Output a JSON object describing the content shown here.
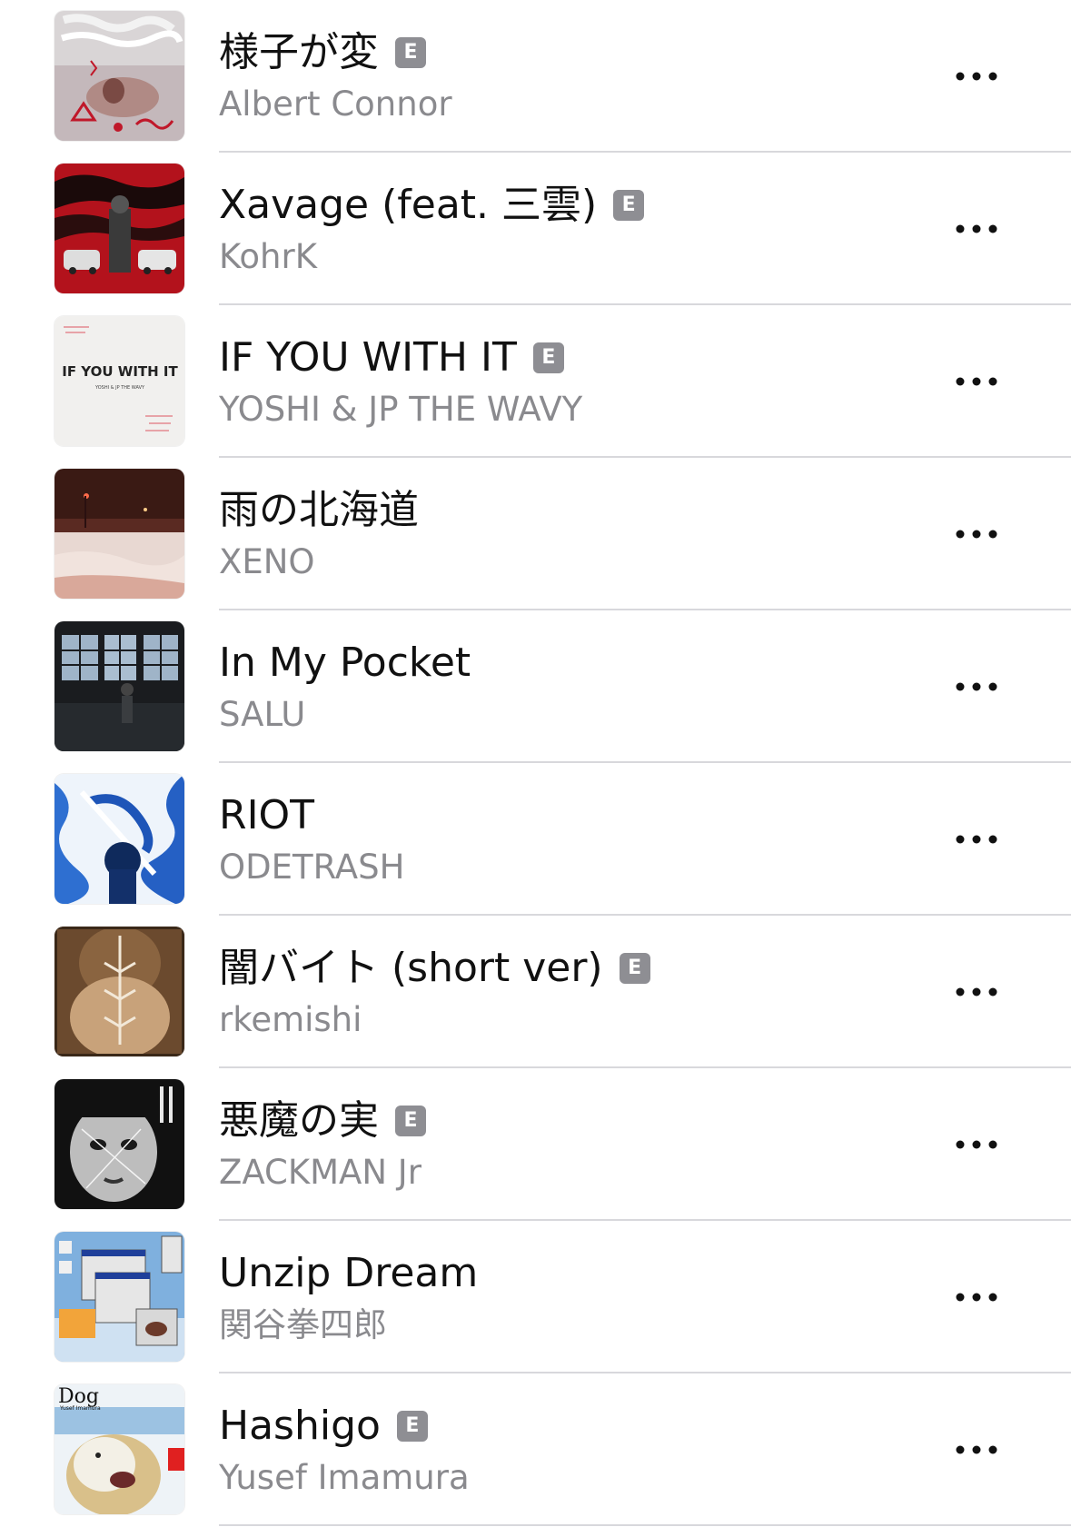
{
  "songs": [
    {
      "title": "様子が変",
      "artist": "Albert Connor",
      "explicit": true,
      "explicit_label": "E",
      "artwork": "album-artwork-25-joyboi"
    },
    {
      "title": "Xavage (feat. 三雲)",
      "artist": "KohrK",
      "explicit": true,
      "explicit_label": "E",
      "artwork": "album-artwork-for-the-reason"
    },
    {
      "title": "IF YOU WITH IT",
      "artist": "YOSHI & JP THE WAVY",
      "explicit": true,
      "explicit_label": "E",
      "artwork": "album-artwork-if-you-with-it",
      "artwork_text": "IF YOU WITH IT",
      "artwork_subtext": "YOSHI & JP THE WAVY"
    },
    {
      "title": "雨の北海道",
      "artist": "XENO",
      "explicit": false,
      "explicit_label": "",
      "artwork": "album-artwork-night-snow"
    },
    {
      "title": "In My Pocket",
      "artist": "SALU",
      "explicit": false,
      "explicit_label": "",
      "artwork": "album-artwork-window-room"
    },
    {
      "title": "RIOT",
      "artist": "ODETRASH",
      "explicit": false,
      "explicit_label": "",
      "artwork": "album-artwork-blue-figure"
    },
    {
      "title": "闇バイト (short ver)",
      "artist": "rkemishi",
      "explicit": true,
      "explicit_label": "E",
      "artwork": "album-artwork-hands"
    },
    {
      "title": "悪魔の実",
      "artist": "ZACKMAN Jr",
      "explicit": true,
      "explicit_label": "E",
      "artwork": "album-artwork-face"
    },
    {
      "title": "Unzip Dream",
      "artist": "関谷拳四郎",
      "explicit": false,
      "explicit_label": "",
      "artwork": "album-artwork-desktop-windows"
    },
    {
      "title": "Hashigo",
      "artist": "Yusef Imamura",
      "explicit": true,
      "explicit_label": "E",
      "artwork": "album-artwork-dog",
      "artwork_text": "Dog",
      "artwork_subtext": "Yusef Imamura"
    }
  ],
  "more_icon": "more-ellipsis-icon",
  "colors": {
    "title": "#111111",
    "artist": "#8a8a8e",
    "explicit_badge": "#8e8e93",
    "divider": "#d8d8dc"
  }
}
